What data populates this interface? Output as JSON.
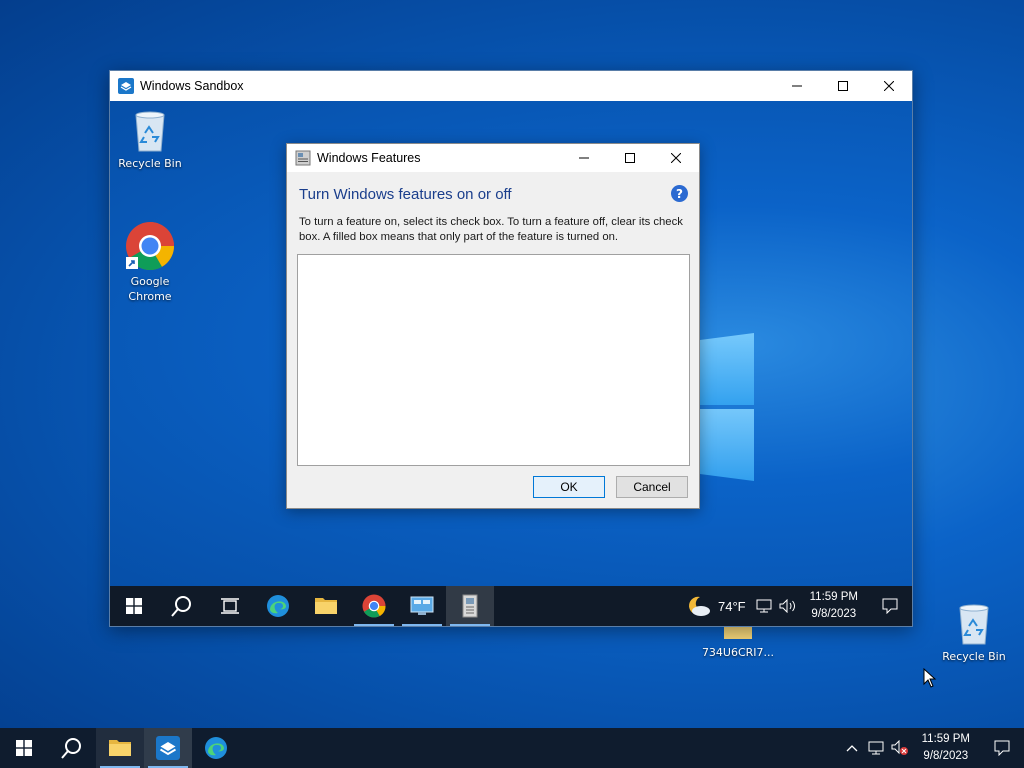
{
  "host_desktop": {
    "icons": [
      {
        "label": "734U6CRI7...",
        "icon": "folder-icon"
      },
      {
        "label": "Recycle Bin",
        "icon": "recycle-bin-icon"
      }
    ]
  },
  "sandbox_window": {
    "title": "Windows Sandbox",
    "desktop_icons": [
      {
        "label": "Recycle Bin",
        "icon": "recycle-bin-icon"
      },
      {
        "label": "Google Chrome",
        "icon": "chrome-icon"
      }
    ],
    "taskbar": {
      "weather_temp": "74°F",
      "time": "11:59 PM",
      "date": "9/8/2023"
    }
  },
  "features_dialog": {
    "title": "Windows Features",
    "heading": "Turn Windows features on or off",
    "description": "To turn a feature on, select its check box. To turn a feature off, clear its check box. A filled box means that only part of the feature is turned on.",
    "ok_label": "OK",
    "cancel_label": "Cancel"
  },
  "host_taskbar": {
    "time": "11:59 PM",
    "date": "9/8/2023"
  },
  "colors": {
    "accent": "#0078d7",
    "heading": "#1a3e8c",
    "taskbar": "#0f1c2e"
  }
}
